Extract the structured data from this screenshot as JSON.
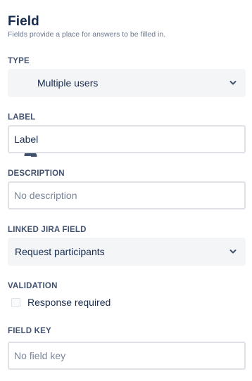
{
  "header": {
    "title": "Field",
    "subtitle": "Fields provide a place for answers to be filled in."
  },
  "type": {
    "label": "TYPE",
    "value": "Multiple users",
    "icon": "users-icon"
  },
  "label_field": {
    "label": "LABEL",
    "value": "Label"
  },
  "description": {
    "label": "DESCRIPTION",
    "placeholder": "No description"
  },
  "linked_jira_field": {
    "label": "LINKED JIRA FIELD",
    "value": "Request participants"
  },
  "validation": {
    "label": "VALIDATION",
    "checkbox_label": "Response required",
    "checked": false
  },
  "field_key": {
    "label": "FIELD KEY",
    "placeholder": "No field key"
  },
  "colors": {
    "text_primary": "#172b4d",
    "text_secondary": "#6b778c",
    "select_bg": "#f4f5f7",
    "input_border": "#dfe1e6"
  }
}
